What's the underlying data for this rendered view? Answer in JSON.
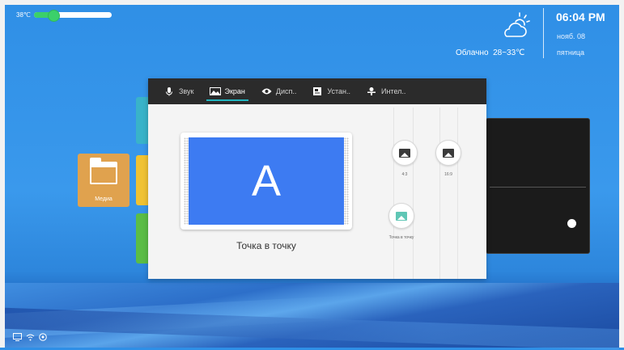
{
  "status_top": {
    "temperature_label": "38℃",
    "temperature_level": 0.25
  },
  "weather": {
    "icon": "partly-cloudy-icon",
    "condition": "Облачно",
    "range": "28~33℃",
    "time": "06:04 PM",
    "date": "нояб. 08",
    "weekday": "пятница"
  },
  "home_tiles": {
    "media_label": "Медиа"
  },
  "dialog": {
    "tabs": [
      {
        "label": "Звук",
        "icon": "microphone-icon"
      },
      {
        "label": "Экран",
        "icon": "picture-icon"
      },
      {
        "label": "Дисп..",
        "icon": "eye-icon"
      },
      {
        "label": "Устан..",
        "icon": "settings-doc-icon"
      },
      {
        "label": "Интел..",
        "icon": "trophy-icon"
      }
    ],
    "active_tab": "Экран",
    "preview_letter": "A",
    "current_mode": "Точка в точку",
    "options": [
      {
        "label": "4:3",
        "icon": "image-icon"
      },
      {
        "label": "16:9",
        "icon": "image-icon"
      },
      {
        "label": "Точка в точку",
        "icon": "image-selected-icon"
      }
    ]
  },
  "colors": {
    "accent": "#21b6c0",
    "desktop": "#3a99ec",
    "tab_bar": "#2b2b2b",
    "preview": "#3d7bf2"
  }
}
